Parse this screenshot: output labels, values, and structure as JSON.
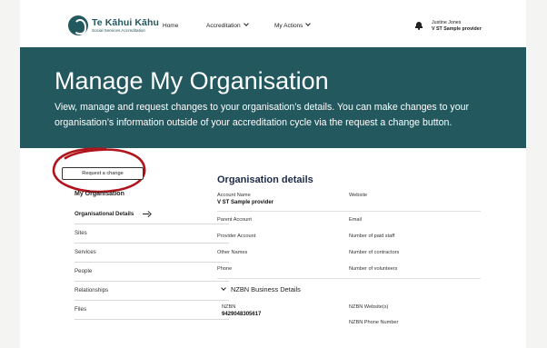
{
  "header": {
    "logo_title": "Te Kāhui Kāhu",
    "logo_subtitle": "Social Services Accreditation",
    "nav": {
      "home": "Home",
      "accreditation": "Accreditation",
      "my_actions": "My Actions"
    },
    "user_name": "Justine Jones",
    "user_org": "V ST Sample provider",
    "icons": {
      "bell": "bell-icon",
      "chevron": "chevron-down-icon"
    }
  },
  "hero": {
    "title": "Manage My Organisation",
    "description": "View, manage and request changes to your organisation’s details. You can make changes to your organisation’s information outside of your accreditation cycle via the request a change button.",
    "background_color": "#23585f"
  },
  "request_button": "Request a change",
  "sidebar": {
    "heading": "My Organisation",
    "items": [
      {
        "label": "Organisational Details",
        "active": true
      },
      {
        "label": "Sites"
      },
      {
        "label": "Services"
      },
      {
        "label": "People"
      },
      {
        "label": "Relationships"
      },
      {
        "label": "Files"
      }
    ]
  },
  "main": {
    "heading": "Organisation details",
    "fields_left": {
      "account_name_label": "Account Name",
      "account_name_value": "V ST Sample provider",
      "parent_account_label": "Parent Account",
      "provider_account_label": "Provider Account",
      "other_names_label": "Other Names",
      "phone_label": "Phone"
    },
    "fields_right": {
      "website_label": "Website",
      "email_label": "Email",
      "paid_staff_label": "Number of paid staff",
      "contractors_label": "Number of contractors",
      "volunteers_label": "Number of volunteers"
    },
    "nzbn": {
      "heading": "NZBN Business Details",
      "nzbn_label": "NZBN",
      "nzbn_value": "9429048305617",
      "website_label": "NZBN Website(s)",
      "phone_label": "NZBN Phone Number"
    }
  }
}
